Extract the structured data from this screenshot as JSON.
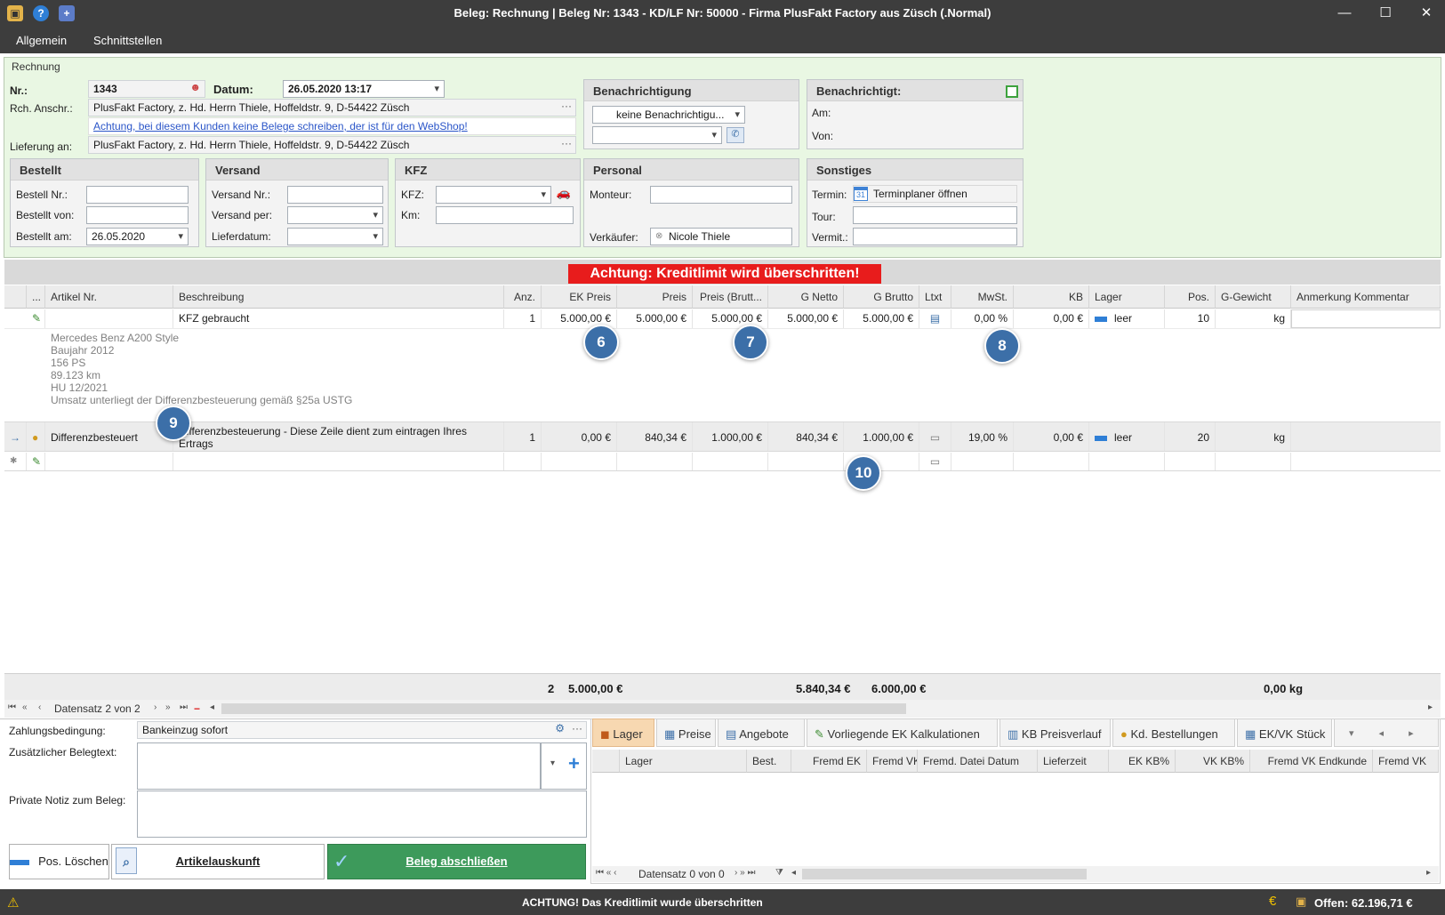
{
  "window": {
    "title": "Beleg: Rechnung  |  Beleg Nr: 1343  -  KD/LF Nr: 50000 - Firma PlusFakt Factory  aus Züsch (.Normal)"
  },
  "menu": [
    "Allgemein",
    "Schnittstellen"
  ],
  "header": {
    "group_label": "Rechnung",
    "nr_label": "Nr.:",
    "nr_value": "1343",
    "datum_label": "Datum:",
    "datum_value": "26.05.2020 13:17",
    "rch_label": "Rch. Anschr.:",
    "rch_value": "PlusFakt Factory, z. Hd. Herrn Thiele, Hoffeldstr. 9,  D-54422 Züsch",
    "warning_link": "Achtung, bei diesem Kunden keine Belege schreiben, der ist für den WebShop!",
    "lief_label": "Lieferung an:",
    "lief_value": "PlusFakt Factory, z. Hd. Herrn Thiele, Hoffeldstr. 9,  D-54422 Züsch"
  },
  "benachrichtigung": {
    "title": "Benachrichtigung",
    "select_value": "keine Benachrichtigu...",
    "second_value": ""
  },
  "benachrichtigt": {
    "title": "Benachrichtigt:",
    "am_label": "Am:",
    "von_label": "Von:"
  },
  "bestellt": {
    "title": "Bestellt",
    "nr_label": "Bestell Nr.:",
    "von_label": "Bestellt von:",
    "am_label": "Bestellt am:",
    "am_value": "26.05.2020"
  },
  "versand": {
    "title": "Versand",
    "nr_label": "Versand Nr.:",
    "per_label": "Versand per:",
    "datum_label": "Lieferdatum:"
  },
  "kfz": {
    "title": "KFZ",
    "kfz_label": "KFZ:",
    "km_label": "Km:"
  },
  "personal": {
    "title": "Personal",
    "monteur_label": "Monteur:",
    "verkaeufer_label": "Verkäufer:",
    "verkaeufer_value": "Nicole Thiele"
  },
  "sonstiges": {
    "title": "Sonstiges",
    "termin_label": "Termin:",
    "termin_button": "Terminplaner öffnen",
    "tour_label": "Tour:",
    "vermit_label": "Vermit.:"
  },
  "banner": "Achtung: Kreditlimit wird überschritten!",
  "grid": {
    "columns": [
      "...",
      "Artikel Nr.",
      "Beschreibung",
      "Anz.",
      "EK Preis",
      "Preis",
      "Preis (Brutt...",
      "G Netto",
      "G Brutto",
      "Ltxt",
      "MwSt.",
      "KB",
      "Lager",
      "Pos.",
      "G-Gewicht",
      "Anmerkung Kommentar"
    ],
    "rows": [
      {
        "artikel": "",
        "beschreibung": "KFZ gebraucht",
        "anz": "1",
        "ek": "5.000,00 €",
        "preis": "5.000,00 €",
        "brutto": "5.000,00 €",
        "gnetto": "5.000,00 €",
        "gbrutto": "5.000,00 €",
        "mwst": "0,00 %",
        "kb": "0,00 €",
        "lager": "leer",
        "pos": "10",
        "gewicht": "kg",
        "details": [
          "Mercedes Benz A200 Style",
          "Baujahr 2012",
          "156 PS",
          "89.123 km",
          "HU 12/2021",
          "Umsatz unterliegt der Differenzbesteuerung gemäß §25a USTG"
        ]
      },
      {
        "artikel": "Differenzbesteuert",
        "beschreibung": "Differenzbesteuerung - Diese Zeile dient zum eintragen Ihres Ertrags",
        "anz": "1",
        "ek": "0,00 €",
        "preis": "840,34 €",
        "brutto": "1.000,00 €",
        "gnetto": "840,34 €",
        "gbrutto": "1.000,00 €",
        "mwst": "19,00 %",
        "kb": "0,00 €",
        "lager": "leer",
        "pos": "20",
        "gewicht": "kg"
      }
    ],
    "callouts": [
      "6",
      "7",
      "8",
      "9",
      "10"
    ]
  },
  "totals": {
    "anz": "2",
    "ek": "5.000,00 €",
    "gnetto": "5.840,34 €",
    "gbrutto": "6.000,00 €",
    "gewicht": "0,00 kg"
  },
  "nav": {
    "record_text": "Datensatz 2 von 2"
  },
  "bottom_left": {
    "zahl_label": "Zahlungsbedingung:",
    "zahl_value": "Bankeinzug sofort",
    "zusatz_label": "Zusätzlicher Belegtext:",
    "notiz_label": "Private Notiz zum Beleg:",
    "btn_loeschen": "Pos. Löschen",
    "btn_auskunft": "Artikelauskunft",
    "btn_abschliessen": "Beleg abschließen"
  },
  "tabs": [
    "Lager",
    "Preise",
    "Angebote",
    "Vorliegende EK Kalkulationen",
    "KB Preisverlauf",
    "Kd. Bestellungen",
    "EK/VK Stück"
  ],
  "subgrid": {
    "columns": [
      "Lager",
      "Best.",
      "Fremd EK",
      "Fremd VK",
      "Fremd. Datei Datum",
      "Lieferzeit",
      "EK KB%",
      "VK KB%",
      "Fremd VK Endkunde",
      "Fremd VK"
    ],
    "nav_text": "Datensatz 0 von 0"
  },
  "status": {
    "warning": "ACHTUNG! Das Kreditlimit wurde überschritten",
    "offen": "Offen: 62.196,71 €"
  },
  "colors": {
    "titlebar": "#3d3d3d",
    "header_bg": "#e9f7e3",
    "banner": "#e81c1c",
    "callout": "#3c6fa8",
    "active_tab": "#f7d8b1",
    "confirm_button": "#3d9a5b"
  }
}
